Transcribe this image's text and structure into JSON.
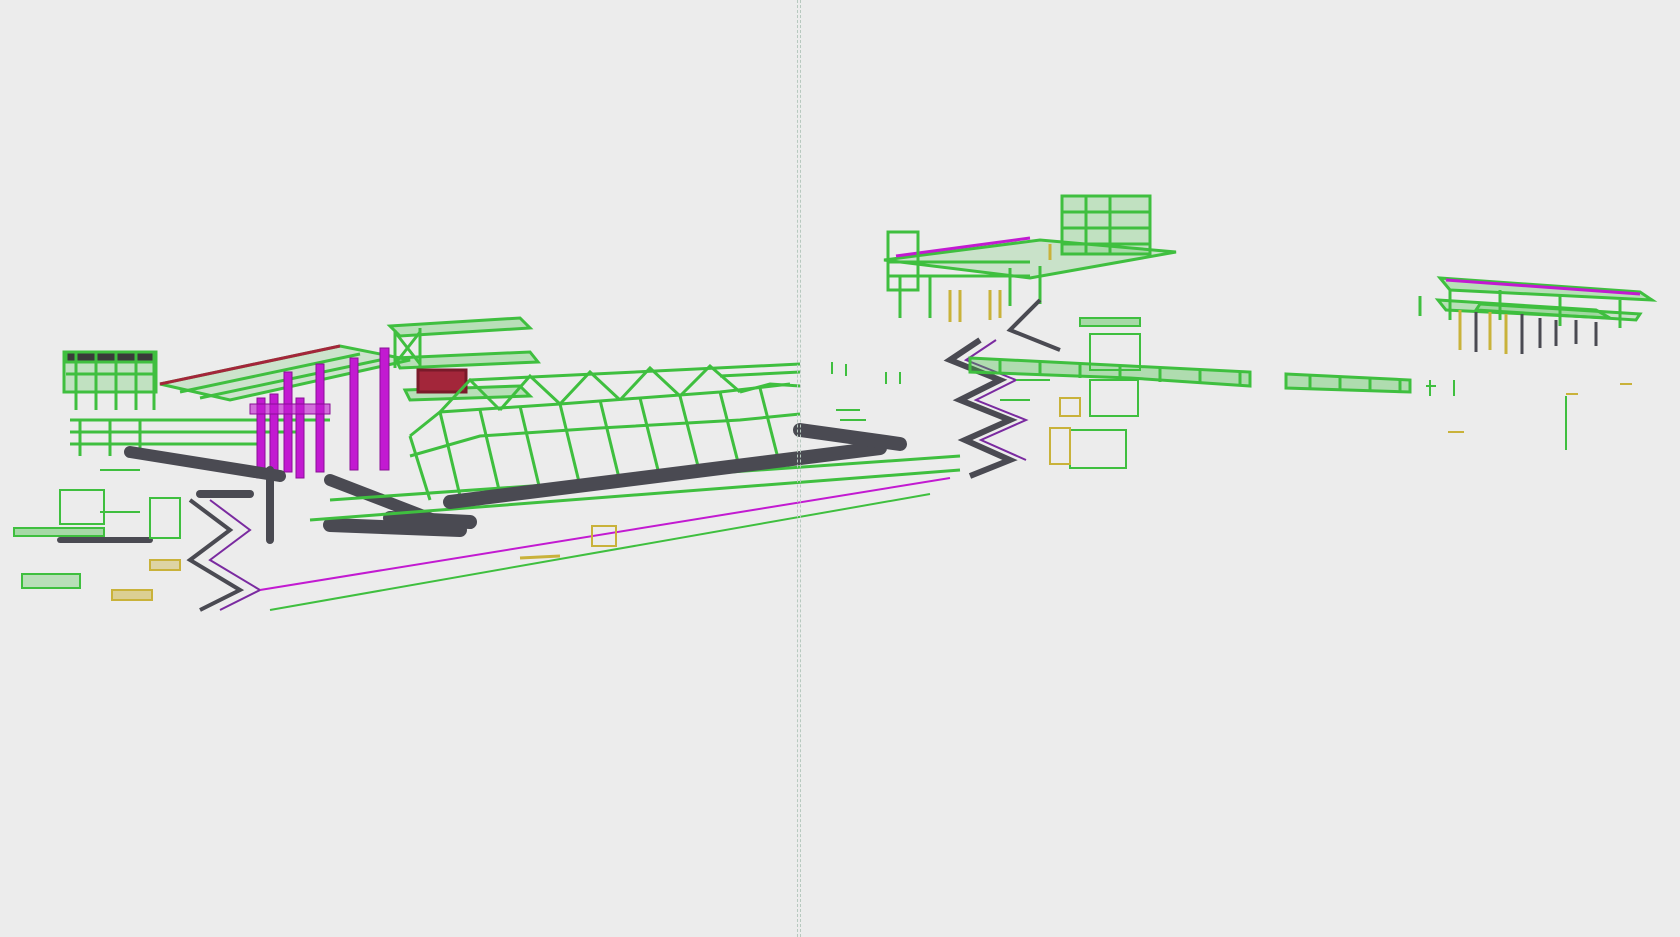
{
  "viewport": {
    "background": "#ececec",
    "view_mode": "3D model view",
    "split": "vertical"
  },
  "colors": {
    "structure_green": "#3fbf3f",
    "structure_green_dark": "#1f7f1f",
    "pipe_gray": "#4a4a52",
    "column_magenta": "#c21ad1",
    "accent_yellow": "#c9b23a",
    "panel_red": "#a3263a",
    "split_line": "#b7c9bf"
  }
}
